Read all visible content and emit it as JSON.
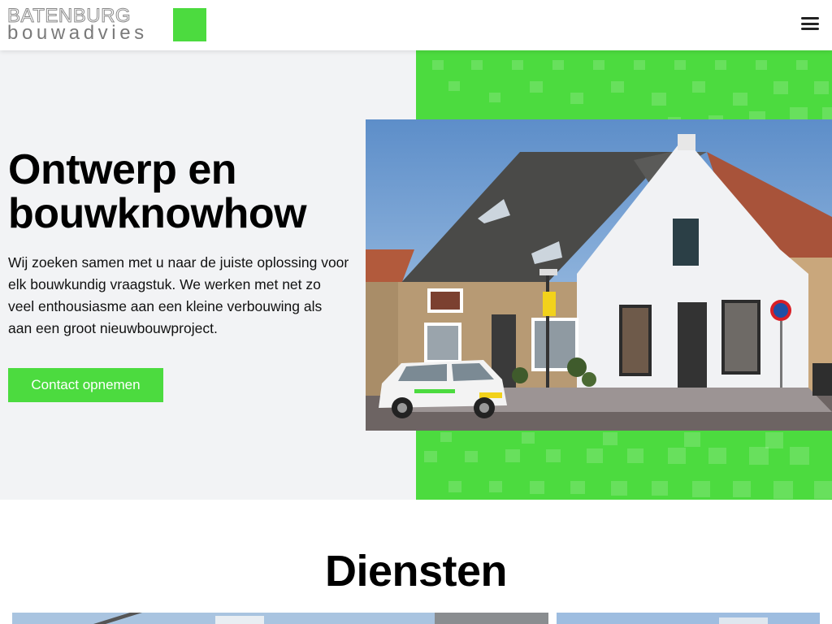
{
  "theme": {
    "green": "#4cdb3f"
  },
  "header": {
    "logo_top": "BATENBURG",
    "logo_bottom": "bouwadvies",
    "menu_icon": "hamburger-menu-icon"
  },
  "hero": {
    "title_line1": "Ontwerp en",
    "title_line2": "bouwknowhow",
    "text": "Wij zoeken samen met u naar de juiste oplossing voor elk bouwkundig vraagstuk. We werken met net zo veel enthousiasme aan een kleine verbouwing als aan een groot nieuwbouwproject.",
    "cta_label": "Contact opnemen",
    "photo": "house-with-car-photo"
  },
  "diensten": {
    "title": "Diensten",
    "cards": [
      "service-card-1-photo",
      "service-card-2-photo"
    ]
  }
}
